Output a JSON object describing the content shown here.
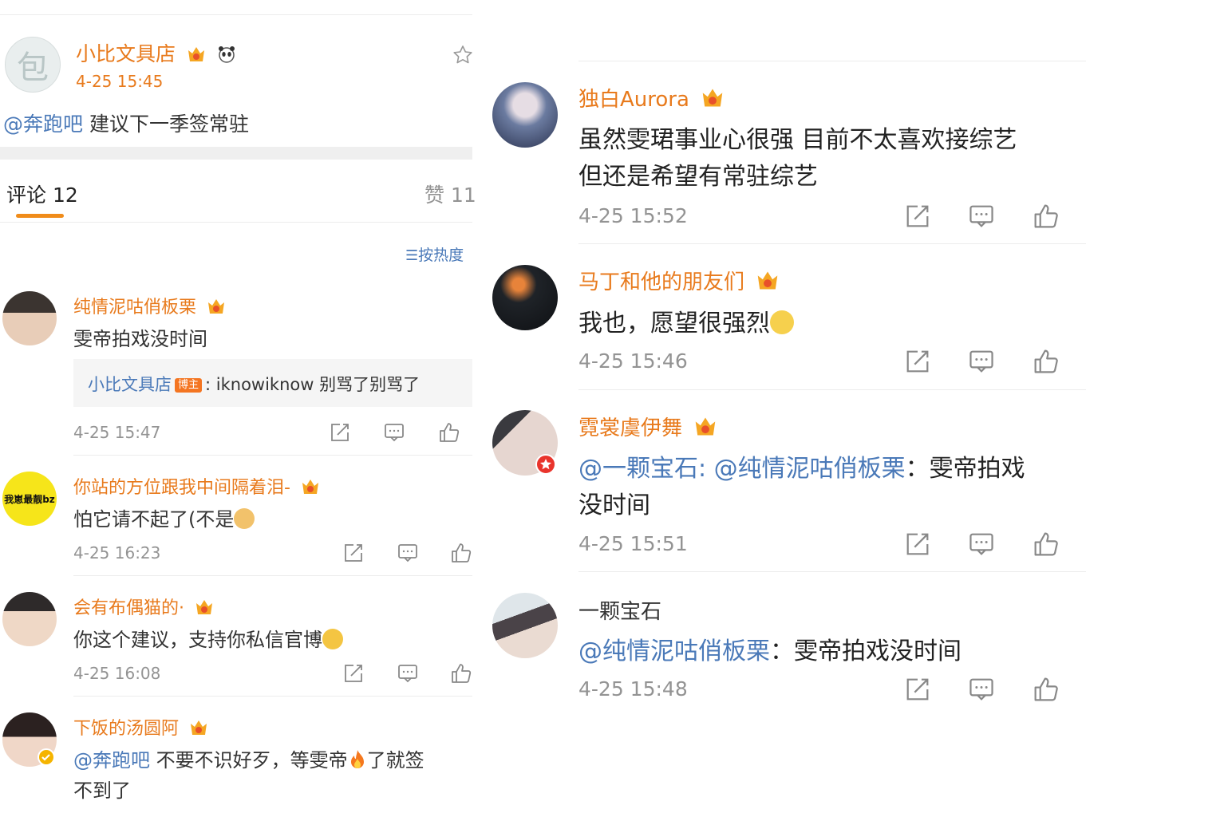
{
  "left": {
    "post": {
      "author": "小比文具店",
      "time": "4-25 15:45",
      "avatar_char": "包",
      "mention": "@奔跑吧",
      "text": " 建议下一季签常驻"
    },
    "tabs": {
      "comments_label": "评论 12",
      "likes_label": "赞 11"
    },
    "sort_label": "按热度",
    "comments": [
      {
        "name": "纯情泥咕俏板栗",
        "text": "雯帝拍戏没时间",
        "time": "4-25 15:47",
        "reply": {
          "author": "小比文具店",
          "badge": "博主",
          "text": ": iknowiknow 别骂了别骂了"
        }
      },
      {
        "name": "你站的方位跟我中间隔着泪-",
        "text": "怕它请不起了(不是",
        "time": "4-25 16:23",
        "avatar_text": "我崽最靓bz"
      },
      {
        "name": "会有布偶猫的·",
        "text": "你这个建议，支持你私信官博",
        "time": "4-25 16:08"
      },
      {
        "name": "下饭的汤圆阿",
        "mention": "@奔跑吧",
        "text": " 不要不识好歹，等雯帝",
        "text2": "了就签",
        "text3": "不到了"
      }
    ]
  },
  "right": {
    "comments": [
      {
        "name": "独白Aurora",
        "line1": "虽然雯珺事业心很强 目前不太喜欢接综艺",
        "line2": "但还是希望有常驻综艺",
        "time": "4-25 15:52"
      },
      {
        "name": "马丁和他的朋友们",
        "line1": "我也，愿望很强烈",
        "time": "4-25 15:46"
      },
      {
        "name": "霓裳虞伊舞",
        "mention1": "@一颗宝石",
        "sep": ": ",
        "mention2": "@纯情泥咕俏板栗",
        "line1_tail": "：雯帝拍戏",
        "line2": "没时间",
        "time": "4-25 15:51"
      },
      {
        "name": "一颗宝石",
        "mention": "@纯情泥咕俏板栗",
        "line1_tail": "：雯帝拍戏没时间",
        "time": "4-25 15:48"
      }
    ]
  },
  "colors": {
    "name": "#e87a1c",
    "link": "#4a79b8",
    "time": "#939393",
    "tab_indicator": "#f08c1a"
  }
}
